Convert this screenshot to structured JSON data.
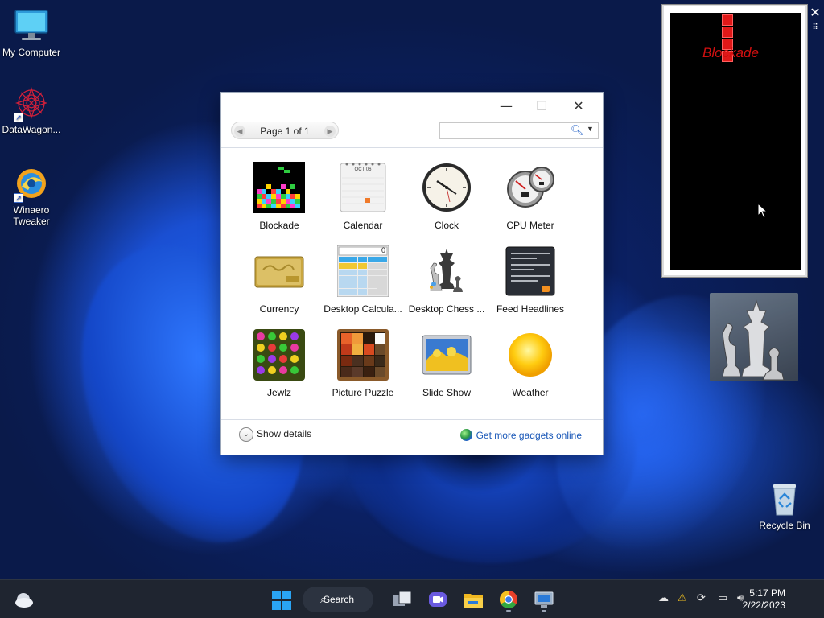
{
  "desktop": {
    "icons": [
      {
        "label": "My Computer",
        "icon": "monitor-icon"
      },
      {
        "label": "DataWagon...",
        "icon": "datawagon-icon"
      },
      {
        "label": "Winaero Tweaker",
        "icon": "winaero-icon"
      },
      {
        "label": "Recycle Bin",
        "icon": "recycle-bin-icon"
      }
    ]
  },
  "gadget_window": {
    "controls": {
      "minimize": "—",
      "maximize": "☐",
      "close": "✕"
    },
    "pager": {
      "prev": "◀",
      "label": "Page 1 of 1",
      "next": "▶"
    },
    "search": {
      "placeholder": "",
      "value": ""
    },
    "gadgets": [
      {
        "label": "Blockade",
        "icon": "blockade-icon"
      },
      {
        "label": "Calendar",
        "icon": "calendar-icon"
      },
      {
        "label": "Clock",
        "icon": "clock-icon"
      },
      {
        "label": "CPU Meter",
        "icon": "cpu-meter-icon"
      },
      {
        "label": "Currency",
        "icon": "currency-icon"
      },
      {
        "label": "Desktop Calcula...",
        "icon": "calculator-icon"
      },
      {
        "label": "Desktop Chess ...",
        "icon": "chess-icon"
      },
      {
        "label": "Feed Headlines",
        "icon": "feed-icon"
      },
      {
        "label": "Jewlz",
        "icon": "jewels-icon"
      },
      {
        "label": "Picture Puzzle",
        "icon": "puzzle-icon"
      },
      {
        "label": "Slide Show",
        "icon": "slideshow-icon"
      },
      {
        "label": "Weather",
        "icon": "weather-icon"
      }
    ],
    "calendar_month": "OCT 06",
    "calculator_display": "0",
    "show_details": "Show details",
    "more_gadgets": "Get more gadgets online"
  },
  "blockade_gadget": {
    "title": "Blockade",
    "close": "✕",
    "drag": "⠿"
  },
  "taskbar": {
    "search_label": "Search",
    "time": "5:17 PM",
    "date": "2/22/2023"
  },
  "colors": {
    "accent": "#1a58b8",
    "blockade_red": "#d01010",
    "taskbar": "#1f2530"
  }
}
